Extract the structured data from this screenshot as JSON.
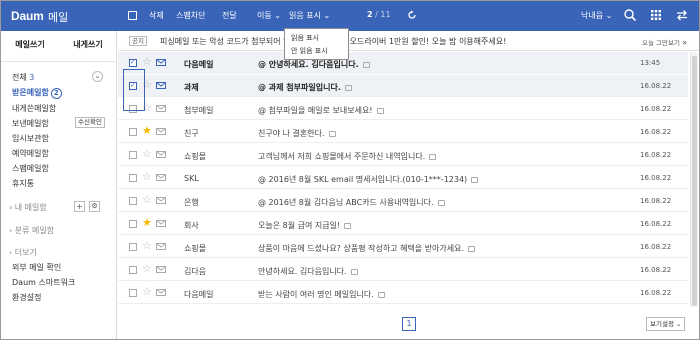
{
  "brand": {
    "logo": "Daum",
    "service": "메일"
  },
  "toolbar": {
    "delete": "삭제",
    "spam": "스팸차단",
    "forward": "전달",
    "move": "이동",
    "read_mark": "읽음 표시",
    "page_current": "2",
    "page_total": "/ 11",
    "user": "낙내읍",
    "icons": [
      "checkbox-icon",
      "chevron-down-icon",
      "refresh-icon",
      "chevron-down-icon",
      "search-icon",
      "apps-grid-icon",
      "swap-icon"
    ]
  },
  "dropdown": {
    "options": [
      "읽음 표시",
      "안 읽음 표시"
    ]
  },
  "sidebar": {
    "compose": "메일쓰기",
    "self": "내게쓰기",
    "all": "전체",
    "all_count": "3",
    "inbox": "받은메일함",
    "inbox_count": "2",
    "self_box": "내게쓴메일함",
    "sent": "보낸메일함",
    "sent_check": "수신확인",
    "draft": "임시보관함",
    "reserved": "예약메일함",
    "spam_box": "스팸메일함",
    "trash": "휴지통",
    "my_folders": "내 메일함",
    "category": "분류 메일함",
    "more": "더보기",
    "external": "외부 메일 확인",
    "daum_smartwork": "Daum 스마트워크",
    "settings": "환경설정",
    "icons": [
      "chevron-down-icon",
      "plus-icon",
      "settings-icon"
    ]
  },
  "notice": {
    "tag": "공지",
    "text": "피싱메일 또는 악성 코드가 첨부되어 있                                       은 대리운전 카카오드라이버 1만원 할인! 오늘 밤 이용해주세요!",
    "close": "오늘 그만보기"
  },
  "rows": [
    {
      "sender": "다음메일",
      "subject": "안녕하세요. 김다음입니다.",
      "date": "13:45",
      "checked": true,
      "star": false,
      "unread": true,
      "attach": true
    },
    {
      "sender": "과제",
      "subject": "과제 첨부파일입니다.",
      "date": "16.08.22",
      "checked": true,
      "star": false,
      "unread": true,
      "attach": true
    },
    {
      "sender": "첨부메일",
      "subject": "첨부파일을 메일로 보내보세요!",
      "date": "16.08.22",
      "checked": false,
      "star": false,
      "unread": false,
      "attach": true
    },
    {
      "sender": "친구",
      "subject": "친구야 나 결혼한다.",
      "date": "16.08.22",
      "checked": false,
      "star": true,
      "unread": false,
      "attach": false
    },
    {
      "sender": "쇼핑몰",
      "subject": "고객님께서 저희 쇼핑몰에서 주문하신 내역입니다.",
      "date": "16.08.22",
      "checked": false,
      "star": false,
      "unread": false,
      "attach": false
    },
    {
      "sender": "SKL",
      "subject": "2016년 8월 SKL email 명세서입니다.(010-1***-1234)",
      "date": "16.08.22",
      "checked": false,
      "star": false,
      "unread": false,
      "attach": true
    },
    {
      "sender": "은행",
      "subject": "2016년 8월 김다음님 ABC카드 사용내역입니다.",
      "date": "16.08.22",
      "checked": false,
      "star": false,
      "unread": false,
      "attach": true
    },
    {
      "sender": "회사",
      "subject": "오늘은 8월 급여 지급일!",
      "date": "16.08.22",
      "checked": false,
      "star": true,
      "unread": false,
      "attach": false
    },
    {
      "sender": "쇼핑몰",
      "subject": "상품이 마음에 드셨나요? 상품평 작성하고 혜택을 받아가세요.",
      "date": "16.08.22",
      "checked": false,
      "star": false,
      "unread": false,
      "attach": false
    },
    {
      "sender": "김다음",
      "subject": "안녕하세요. 김다음입니다.",
      "date": "16.08.22",
      "checked": false,
      "star": false,
      "unread": false,
      "attach": false
    },
    {
      "sender": "다음메일",
      "subject": "받는 사람이 여러 명인 메일입니다.",
      "date": "16.08.22",
      "checked": false,
      "star": false,
      "unread": false,
      "attach": false
    }
  ],
  "pager": {
    "page": "1"
  },
  "view_settings": "보기설정",
  "colors": {
    "accent": "#3a64b8",
    "star": "#f5b800"
  }
}
